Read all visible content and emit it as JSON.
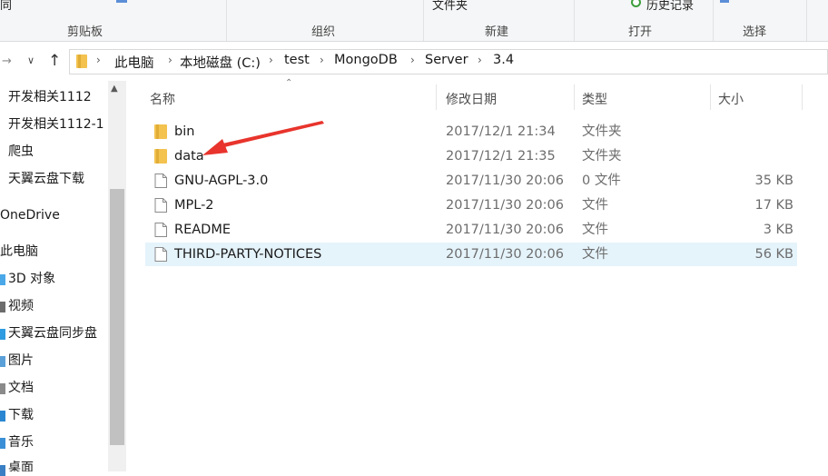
{
  "ribbon": {
    "top_fragments": {
      "left": "同",
      "new_folder": "文件夹",
      "history": "历史记录"
    },
    "groups": {
      "clipboard": "剪贴板",
      "organize": "组织",
      "new": "新建",
      "open": "打开",
      "select": "选择"
    }
  },
  "address": {
    "crumbs": [
      "此电脑",
      "本地磁盘 (C:)",
      "test",
      "MongoDB",
      "Server",
      "3.4"
    ]
  },
  "nav": {
    "items": [
      "开发相关1112",
      "开发相关1112-1",
      "爬虫",
      "天翼云盘下载",
      "OneDrive",
      "此电脑",
      "3D 对象",
      "视频",
      "天翼云盘同步盘",
      "图片",
      "文档",
      "下载",
      "音乐",
      "桌面"
    ]
  },
  "columns": {
    "name": "名称",
    "date": "修改日期",
    "type": "类型",
    "size": "大小"
  },
  "files": [
    {
      "name": "bin",
      "date": "2017/12/1 21:34",
      "type": "文件夹",
      "size": "",
      "kind": "folder"
    },
    {
      "name": "data",
      "date": "2017/12/1 21:35",
      "type": "文件夹",
      "size": "",
      "kind": "folder"
    },
    {
      "name": "GNU-AGPL-3.0",
      "date": "2017/11/30 20:06",
      "type": "0 文件",
      "size": "35 KB",
      "kind": "file"
    },
    {
      "name": "MPL-2",
      "date": "2017/11/30 20:06",
      "type": "文件",
      "size": "17 KB",
      "kind": "file"
    },
    {
      "name": "README",
      "date": "2017/11/30 20:06",
      "type": "文件",
      "size": "3 KB",
      "kind": "file"
    },
    {
      "name": "THIRD-PARTY-NOTICES",
      "date": "2017/11/30 20:06",
      "type": "文件",
      "size": "56 KB",
      "kind": "file"
    }
  ],
  "colors": {
    "accent": "#e5f3fb",
    "folder": "#f3c24f",
    "arrow": "#e8342c"
  }
}
